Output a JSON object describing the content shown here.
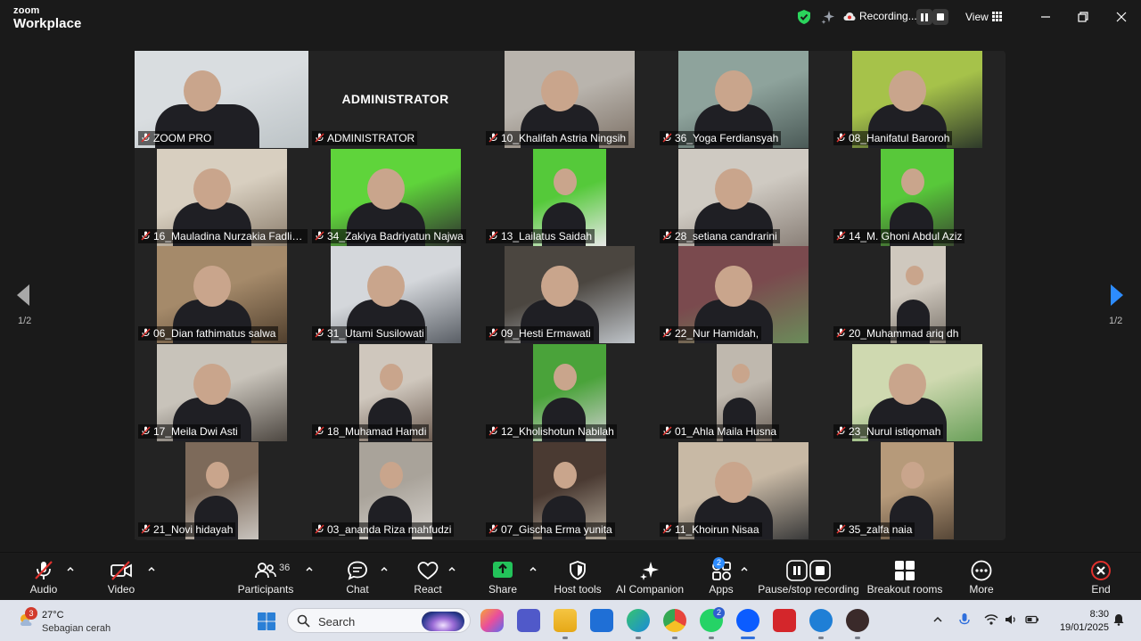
{
  "app": {
    "logo_line1": "zoom",
    "logo_line2": "Workplace"
  },
  "titlebar": {
    "recording_label": "Recording...",
    "view_label": "View"
  },
  "gallery": {
    "page_indicator_left": "1/2",
    "page_indicator_right": "1/2",
    "admin_placeholder": "ADMINISTRATOR",
    "participants": [
      "ZOOM PRO",
      "ADMINISTRATOR",
      "10_Khalifah Astria Ningsih",
      "36_Yoga Ferdiansyah",
      "08_Hanifatul Baroroh",
      "16_Mauladina Nurzakia Fadliy...",
      "34_Zakiya Badriyatun Najwa",
      "13_Lailatus Saidah",
      "28_setiana candrarini",
      "14_M. Ghoni Abdul Aziz",
      "06_Dian fathimatus salwa",
      "31_Utami Susilowati",
      "09_Hesti Ermawati",
      "22_Nur Hamidah,",
      "20_Muhammad ariq dh",
      "17_Meila Dwi Asti",
      "18_Muhamad Hamdi",
      "12_Kholishotun Nabilah",
      "01_Ahla Maila Husna",
      "23_Nurul istiqomah",
      "21_Novi hidayah",
      "03_ananda Riza mahfudzi",
      "07_Gischa Erma yunita",
      "11_Khoirun Nisaa",
      "35_zalfa naia"
    ]
  },
  "toolbar": {
    "audio": "Audio",
    "video": "Video",
    "participants": "Participants",
    "participants_count": "36",
    "chat": "Chat",
    "react": "React",
    "share": "Share",
    "host_tools": "Host tools",
    "ai_companion": "AI Companion",
    "apps": "Apps",
    "apps_badge": "2",
    "pause_stop_recording": "Pause/stop recording",
    "breakout_rooms": "Breakout rooms",
    "more": "More",
    "end": "End"
  },
  "taskbar": {
    "weather_badge": "3",
    "temperature": "27°C",
    "condition": "Sebagian cerah",
    "search_placeholder": "Search",
    "whatsapp_badge": "2",
    "time": "8:30",
    "date": "19/01/2025"
  },
  "colors": {
    "active_speaker": "#2bd45c",
    "share_green": "#23c35a",
    "end_red": "#e0302c",
    "nav_arrow_active": "#2d8cff"
  }
}
